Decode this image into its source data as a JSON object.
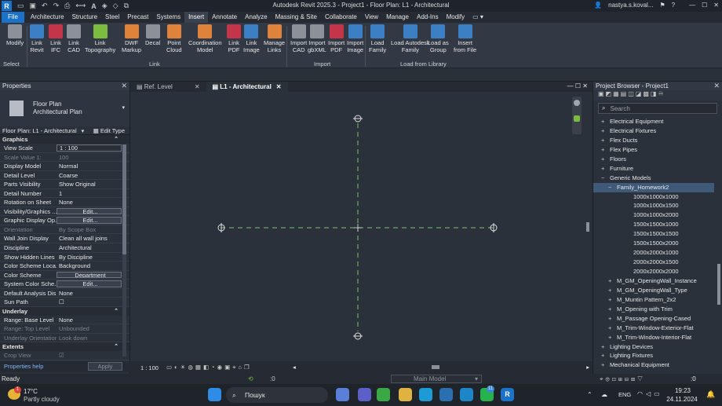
{
  "titlebar": {
    "app_letter": "R",
    "title": "Autodesk Revit 2025.3 - Project1 - Floor Plan: L1 - Architectural",
    "user": "nastya.s.koval...",
    "share_label": "Share"
  },
  "tabs": [
    "File",
    "Architecture",
    "Structure",
    "Steel",
    "Precast",
    "Systems",
    "Insert",
    "Annotate",
    "Analyze",
    "Massing & Site",
    "Collaborate",
    "View",
    "Manage",
    "Add-Ins",
    "Modify"
  ],
  "active_tab": "Insert",
  "ribbon": {
    "buttons": [
      {
        "label": "Modify",
        "color": "grey"
      },
      {
        "label": "Link\nRevit",
        "color": "blue"
      },
      {
        "label": "Link\nIFC",
        "color": "red"
      },
      {
        "label": "Link\nCAD",
        "color": "grey"
      },
      {
        "label": "Link\nTopography",
        "color": "green"
      },
      {
        "label": "DWF\nMarkup",
        "color": "orange"
      },
      {
        "label": "Decal",
        "color": "grey"
      },
      {
        "label": "Point\nCloud",
        "color": "orange"
      },
      {
        "label": "Coordination\nModel",
        "color": "orange"
      },
      {
        "label": "Link\nPDF",
        "color": "red"
      },
      {
        "label": "Link\nImage",
        "color": "blue"
      },
      {
        "label": "Manage\nLinks",
        "color": "orange"
      },
      {
        "label": "Import\nCAD",
        "color": "grey"
      },
      {
        "label": "Import\ngbXML",
        "color": "grey"
      },
      {
        "label": "Import\nPDF",
        "color": "red"
      },
      {
        "label": "Import\nImage",
        "color": "blue"
      },
      {
        "label": "Load\nFamily",
        "color": "blue"
      },
      {
        "label": "Load Autodesk\nFamily",
        "color": "blue"
      },
      {
        "label": "Load as\nGroup",
        "color": "blue"
      },
      {
        "label": "Insert\nfrom File",
        "color": "blue"
      }
    ],
    "panels": [
      "Select",
      "Link",
      "Import",
      "Load from Library"
    ]
  },
  "properties": {
    "title": "Properties",
    "type_name": "Floor Plan\nArchitectural Plan",
    "instance_filter": "Floor Plan: L1 - Architectural",
    "edit_type": "Edit Type",
    "sections": [
      {
        "name": "Graphics",
        "rows": [
          {
            "k": "View Scale",
            "v": "1 : 100",
            "style": "box"
          },
          {
            "k": "Scale Value    1:",
            "v": "100",
            "style": "dis"
          },
          {
            "k": "Display Model",
            "v": "Normal"
          },
          {
            "k": "Detail Level",
            "v": "Coarse"
          },
          {
            "k": "Parts Visibility",
            "v": "Show Original"
          },
          {
            "k": "Detail Number",
            "v": "1"
          },
          {
            "k": "Rotation on Sheet",
            "v": "None"
          },
          {
            "k": "Visibility/Graphics ...",
            "v": "Edit...",
            "style": "btn"
          },
          {
            "k": "Graphic Display Op...",
            "v": "Edit...",
            "style": "btn"
          },
          {
            "k": "Orientation",
            "v": "By Scope Box",
            "style": "dis"
          },
          {
            "k": "Wall Join Display",
            "v": "Clean all wall joins"
          },
          {
            "k": "Discipline",
            "v": "Architectural"
          },
          {
            "k": "Show Hidden Lines",
            "v": "By Discipline"
          },
          {
            "k": "Color Scheme Loca...",
            "v": "Background"
          },
          {
            "k": "Color Scheme",
            "v": "Department",
            "style": "btn"
          },
          {
            "k": "System Color Sche...",
            "v": "Edit...",
            "style": "btn"
          },
          {
            "k": "Default Analysis Dis...",
            "v": "None"
          },
          {
            "k": "Sun Path",
            "v": "☐"
          }
        ]
      },
      {
        "name": "Underlay",
        "rows": [
          {
            "k": "Range: Base Level",
            "v": "None"
          },
          {
            "k": "Range: Top Level",
            "v": "Unbounded",
            "style": "dis"
          },
          {
            "k": "Underlay Orientation",
            "v": "Look down",
            "style": "dis"
          }
        ]
      },
      {
        "name": "Extents",
        "rows": [
          {
            "k": "Crop View",
            "v": "☑",
            "style": "dis"
          }
        ]
      }
    ],
    "help": "Properties help",
    "apply": "Apply"
  },
  "view_tabs": [
    "Ref. Level",
    "L1 - Architectural"
  ],
  "view_scale": "1 : 100",
  "browser": {
    "title": "Project Browser - Project1",
    "search_placeholder": "Search",
    "items": [
      {
        "t": "Electrical Equipment",
        "lvl": 1,
        "pm": "+"
      },
      {
        "t": "Electrical Fixtures",
        "lvl": 1,
        "pm": "+"
      },
      {
        "t": "Flex Ducts",
        "lvl": 1,
        "pm": "+"
      },
      {
        "t": "Flex Pipes",
        "lvl": 1,
        "pm": "+"
      },
      {
        "t": "Floors",
        "lvl": 1,
        "pm": "+"
      },
      {
        "t": "Furniture",
        "lvl": 1,
        "pm": "+"
      },
      {
        "t": "Generic Models",
        "lvl": 1,
        "pm": "−"
      },
      {
        "t": "Family_Homework2",
        "lvl": 2,
        "pm": "−",
        "sel": true
      },
      {
        "t": "1000x1000x1000",
        "lvl": 3,
        "pm": ""
      },
      {
        "t": "1000x1000x1500",
        "lvl": 3,
        "pm": ""
      },
      {
        "t": "1000x1000x2000",
        "lvl": 3,
        "pm": ""
      },
      {
        "t": "1500x1500x1000",
        "lvl": 3,
        "pm": ""
      },
      {
        "t": "1500x1500x1500",
        "lvl": 3,
        "pm": ""
      },
      {
        "t": "1500x1500x2000",
        "lvl": 3,
        "pm": ""
      },
      {
        "t": "2000x2000x1000",
        "lvl": 3,
        "pm": ""
      },
      {
        "t": "2000x2000x1500",
        "lvl": 3,
        "pm": ""
      },
      {
        "t": "2000x2000x2000",
        "lvl": 3,
        "pm": ""
      },
      {
        "t": "M_GM_OpeningWall_Instance",
        "lvl": 2,
        "pm": "+"
      },
      {
        "t": "M_GM_OpeningWall_Type",
        "lvl": 2,
        "pm": "+"
      },
      {
        "t": "M_Muntin Pattern_2x2",
        "lvl": 2,
        "pm": "+"
      },
      {
        "t": "M_Opening with Trim",
        "lvl": 2,
        "pm": "+"
      },
      {
        "t": "M_Passage Opening-Cased",
        "lvl": 2,
        "pm": "+"
      },
      {
        "t": "M_Trim-Window-Exterior-Flat",
        "lvl": 2,
        "pm": "+"
      },
      {
        "t": "M_Trim-Window-Interior-Flat",
        "lvl": 2,
        "pm": "+"
      },
      {
        "t": "Lighting Devices",
        "lvl": 1,
        "pm": "+"
      },
      {
        "t": "Lighting Fixtures",
        "lvl": 1,
        "pm": "+"
      },
      {
        "t": "Mechanical Equipment",
        "lvl": 1,
        "pm": "+"
      }
    ]
  },
  "status": {
    "text": "Ready",
    "model": "Main Model",
    "zero_left": ":0",
    "zero_right": ":0"
  },
  "taskbar": {
    "temp": "17°C",
    "weather": "Partly cloudy",
    "search": "Пошук",
    "lang": "ENG",
    "time": "19:23",
    "date": "24.11.2024",
    "notif": "1",
    "badge": "11"
  }
}
